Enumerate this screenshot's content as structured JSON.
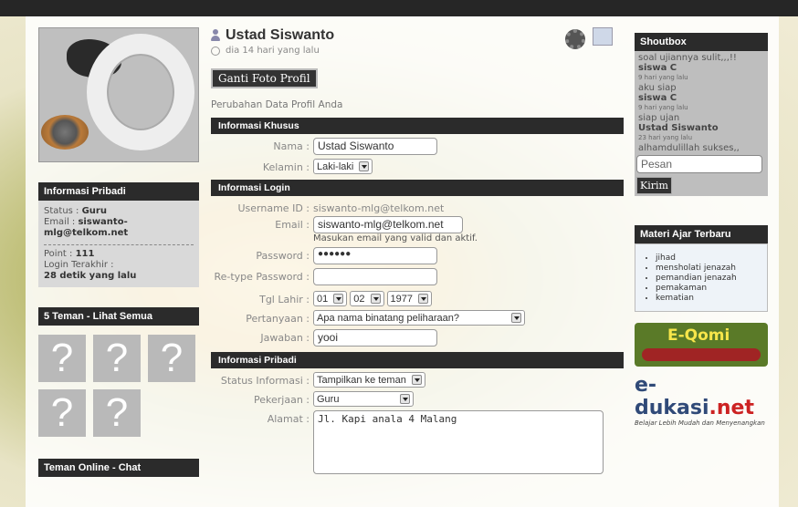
{
  "profile": {
    "name": "Ustad Siswanto",
    "time": "dia 14 hari yang lalu",
    "change_photo": "Ganti Foto Profil",
    "subtitle": "Perubahan Data Profil Anda"
  },
  "left": {
    "info_title": "Informasi Pribadi",
    "status_label": "Status : ",
    "status_value": "Guru",
    "email_label": "Email : ",
    "email_value": "siswanto-mlg@telkom.net",
    "point_label": "Point : ",
    "point_value": "111",
    "login_label": "Login Terakhir :",
    "login_value": "28 detik yang lalu",
    "friends_title": "5 Teman - Lihat Semua",
    "friends": [
      "?",
      "?",
      "?",
      "?",
      "?"
    ],
    "online_title": "Teman Online - Chat"
  },
  "form": {
    "khusus_title": "Informasi Khusus",
    "nama_label": "Nama :",
    "nama_value": "Ustad Siswanto",
    "kelamin_label": "Kelamin :",
    "kelamin_value": "Laki-laki",
    "login_title": "Informasi Login",
    "username_label": "Username ID :",
    "username_value": "siswanto-mlg@telkom.net",
    "email_label": "Email :",
    "email_value": "siswanto-mlg@telkom.net",
    "email_hint": "Masukan email yang valid dan aktif.",
    "password_label": "Password :",
    "password_value": "●●●●●●",
    "retype_label": "Re-type Password :",
    "retype_value": "",
    "tgl_label": "Tgl Lahir :",
    "tgl_day": "01",
    "tgl_month": "02",
    "tgl_year": "1977",
    "pertanyaan_label": "Pertanyaan :",
    "pertanyaan_value": "Apa nama binatang peliharaan?",
    "jawaban_label": "Jawaban :",
    "jawaban_value": "yooi",
    "pribadi_title": "Informasi Pribadi",
    "status_info_label": "Status Informasi :",
    "status_info_value": "Tampilkan ke teman",
    "pekerjaan_label": "Pekerjaan :",
    "pekerjaan_value": "Guru",
    "alamat_label": "Alamat :",
    "alamat_value": "Jl. Kapi anala 4 Malang"
  },
  "shoutbox": {
    "title": "Shoutbox",
    "messages": [
      {
        "txt": "soal ujiannya sulit,,,!!"
      },
      {
        "name": "siswa C",
        "time": "9 hari yang lalu",
        "txt": "aku siap"
      },
      {
        "name": "siswa C",
        "time": "9 hari yang lalu",
        "txt": "siap ujan"
      },
      {
        "name": "Ustad Siswanto",
        "time": "23 hari yang lalu",
        "txt": "alhamdulillah sukses,,"
      }
    ],
    "placeholder": "Pesan",
    "send": "Kirim"
  },
  "materi": {
    "title": "Materi Ajar Terbaru",
    "items": [
      "jihad",
      "mensholati jenazah",
      "pemandian jenazah",
      "pemakaman",
      "kematian"
    ]
  },
  "logos": {
    "eqomi": "E-Qomi",
    "edukasi_main": "e-dukasi",
    "edukasi_tld": ".net",
    "edukasi_tag": "Belajar Lebih Mudah dan Menyenangkan"
  }
}
